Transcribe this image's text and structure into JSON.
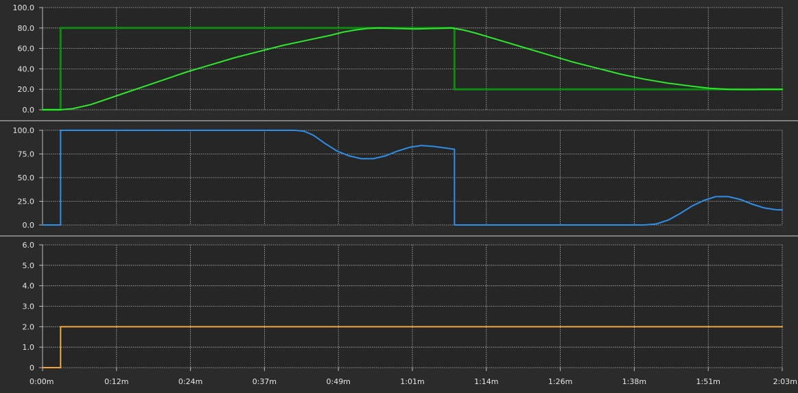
{
  "colors": {
    "background": "#2b2b2b",
    "plot_background": "#262626",
    "grid": "#bdbdbd",
    "separator": "#d0d0d0",
    "setpoint_green": "#0f8a10",
    "process_green": "#2ee82e",
    "output_blue": "#2f8ee8",
    "mode_orange": "#f0a83a"
  },
  "chart_data": [
    {
      "type": "line",
      "title": "",
      "xlabel": "",
      "ylabel": "",
      "xlim": [
        0,
        123
      ],
      "ylim": [
        0,
        100
      ],
      "x_tick_values": [
        0,
        12.3,
        24.6,
        36.9,
        49.2,
        61.5,
        73.8,
        86.1,
        98.4,
        110.7,
        123
      ],
      "x_tick_labels": [
        "0:00m",
        "0:12m",
        "0:24m",
        "0:37m",
        "0:49m",
        "1:01m",
        "1:14m",
        "1:26m",
        "1:38m",
        "1:51m",
        "2:03m"
      ],
      "y_ticks": [
        0,
        20,
        40,
        60,
        80,
        100
      ],
      "y_tick_labels": [
        "0.0",
        "20.0",
        "40.0",
        "60.0",
        "80.0",
        "100.0"
      ],
      "grid": true,
      "series": [
        {
          "color": "#0f8a10",
          "width": 3,
          "points": [
            [
              0,
              0
            ],
            [
              3,
              0
            ],
            [
              3,
              80
            ],
            [
              68.5,
              80
            ],
            [
              68.5,
              20
            ],
            [
              123,
              20
            ]
          ]
        },
        {
          "color": "#2ee82e",
          "width": 2,
          "points": [
            [
              0,
              0
            ],
            [
              3,
              0
            ],
            [
              5,
              1
            ],
            [
              8,
              5
            ],
            [
              12,
              13
            ],
            [
              16,
              21
            ],
            [
              20,
              29
            ],
            [
              24,
              37
            ],
            [
              28,
              44
            ],
            [
              32,
              51
            ],
            [
              36,
              57
            ],
            [
              40,
              63
            ],
            [
              44,
              68
            ],
            [
              48,
              73
            ],
            [
              50,
              76
            ],
            [
              52,
              78
            ],
            [
              54,
              79.5
            ],
            [
              56,
              80
            ],
            [
              59,
              79.5
            ],
            [
              62,
              79
            ],
            [
              65,
              79.5
            ],
            [
              68,
              80
            ],
            [
              70,
              78
            ],
            [
              72,
              75
            ],
            [
              76,
              68
            ],
            [
              80,
              61
            ],
            [
              84,
              54
            ],
            [
              88,
              47
            ],
            [
              92,
              41
            ],
            [
              96,
              35
            ],
            [
              100,
              30
            ],
            [
              104,
              26
            ],
            [
              108,
              23
            ],
            [
              111,
              21
            ],
            [
              114,
              20
            ],
            [
              116,
              19.8
            ],
            [
              118,
              19.8
            ],
            [
              120,
              20
            ],
            [
              123,
              20
            ]
          ]
        }
      ]
    },
    {
      "type": "line",
      "title": "",
      "xlabel": "",
      "ylabel": "",
      "xlim": [
        0,
        123
      ],
      "ylim": [
        0,
        100
      ],
      "y_ticks": [
        0,
        25,
        50,
        75,
        100
      ],
      "y_tick_labels": [
        "0.0",
        "25.0",
        "50.0",
        "75.0",
        "100.0"
      ],
      "grid": true,
      "series": [
        {
          "color": "#2f8ee8",
          "width": 2,
          "points": [
            [
              0,
              0
            ],
            [
              3,
              0
            ],
            [
              3,
              100
            ],
            [
              42,
              100
            ],
            [
              43.5,
              99
            ],
            [
              45,
              95
            ],
            [
              47,
              86
            ],
            [
              49,
              78
            ],
            [
              51,
              73
            ],
            [
              53,
              70
            ],
            [
              55,
              70
            ],
            [
              57,
              73
            ],
            [
              59,
              78
            ],
            [
              61,
              82
            ],
            [
              63,
              84
            ],
            [
              65,
              83
            ],
            [
              68.5,
              80
            ],
            [
              68.5,
              0
            ],
            [
              100,
              0
            ],
            [
              102,
              1
            ],
            [
              104,
              5
            ],
            [
              106,
              12
            ],
            [
              108,
              20
            ],
            [
              110,
              26
            ],
            [
              112,
              30
            ],
            [
              114,
              30
            ],
            [
              116,
              27
            ],
            [
              118,
              22
            ],
            [
              120,
              18
            ],
            [
              122,
              16
            ],
            [
              123,
              16
            ]
          ]
        }
      ]
    },
    {
      "type": "line",
      "title": "",
      "xlabel": "",
      "ylabel": "",
      "xlim": [
        0,
        123
      ],
      "ylim": [
        0,
        6
      ],
      "y_ticks": [
        0,
        1,
        2,
        3,
        4,
        5,
        6
      ],
      "y_tick_labels": [
        "0",
        "1.0",
        "2.0",
        "3.0",
        "4.0",
        "5.0",
        "6.0"
      ],
      "grid": true,
      "series": [
        {
          "color": "#f0a83a",
          "width": 2,
          "points": [
            [
              0,
              0
            ],
            [
              3,
              0
            ],
            [
              3,
              2
            ],
            [
              123,
              2
            ]
          ]
        }
      ]
    }
  ]
}
